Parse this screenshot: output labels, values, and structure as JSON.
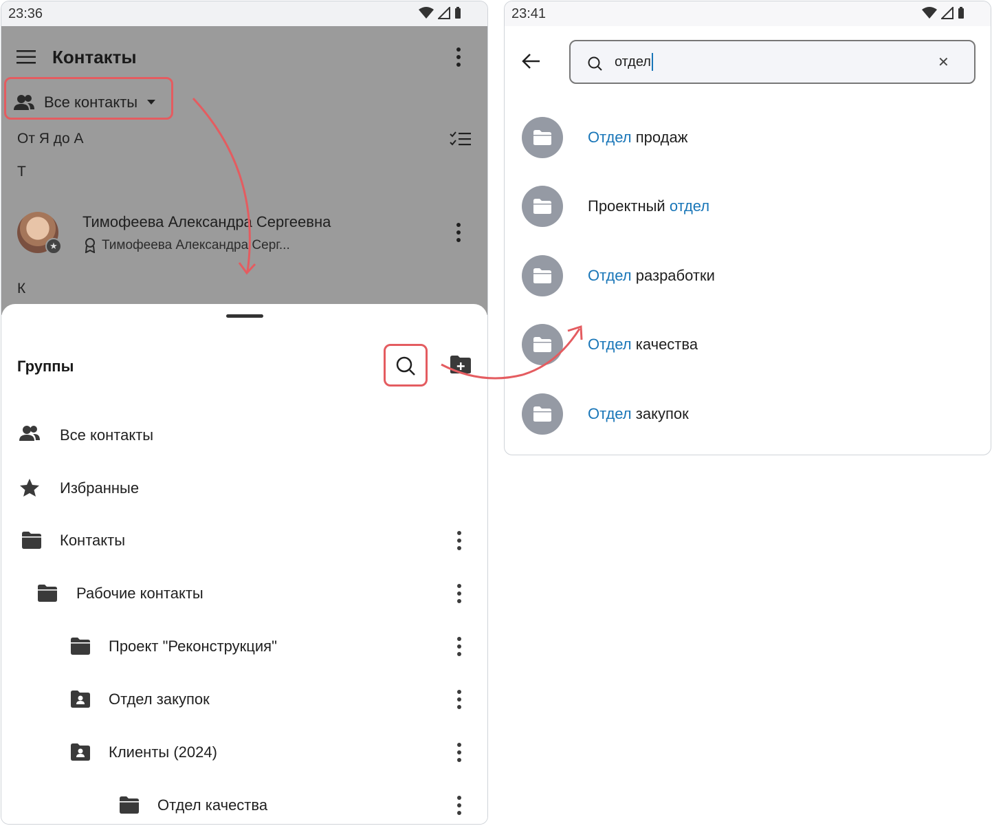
{
  "left": {
    "status_time": "23:36",
    "header_title": "Контакты",
    "filter_label": "Все контакты",
    "sort_label": "От Я до А",
    "section_t": "Т",
    "contact_name": "Тимофеева Александра Сергеевна",
    "contact_sub": "Тимофеева Александра Серг...",
    "section_k": "К",
    "sheet_title": "Группы",
    "groups": [
      {
        "label": "Все контакты",
        "icon": "people-icon"
      },
      {
        "label": "Избранные",
        "icon": "star-icon"
      },
      {
        "label": "Контакты",
        "icon": "folder-icon"
      },
      {
        "label": "Рабочие контакты",
        "icon": "folder-icon"
      },
      {
        "label": "Проект \"Реконструкция\"",
        "icon": "folder-icon"
      },
      {
        "label": "Отдел закупок",
        "icon": "folder-person-icon"
      },
      {
        "label": "Клиенты (2024)",
        "icon": "folder-person-icon"
      },
      {
        "label": "Отдел качества",
        "icon": "folder-icon"
      }
    ]
  },
  "right": {
    "status_time": "23:41",
    "search_value": "отдел",
    "results": [
      {
        "pre": "",
        "match": "Отдел",
        "post": " продаж"
      },
      {
        "pre": "Проектный ",
        "match": "отдел",
        "post": ""
      },
      {
        "pre": "",
        "match": "Отдел",
        "post": " разработки"
      },
      {
        "pre": "",
        "match": "Отдел",
        "post": " качества"
      },
      {
        "pre": "",
        "match": "Отдел",
        "post": " закупок"
      }
    ]
  },
  "colors": {
    "highlight": "#1976b8",
    "annotation": "#e45c60",
    "scrim": "#9b9b9b",
    "folder_circle": "#959aa4"
  }
}
